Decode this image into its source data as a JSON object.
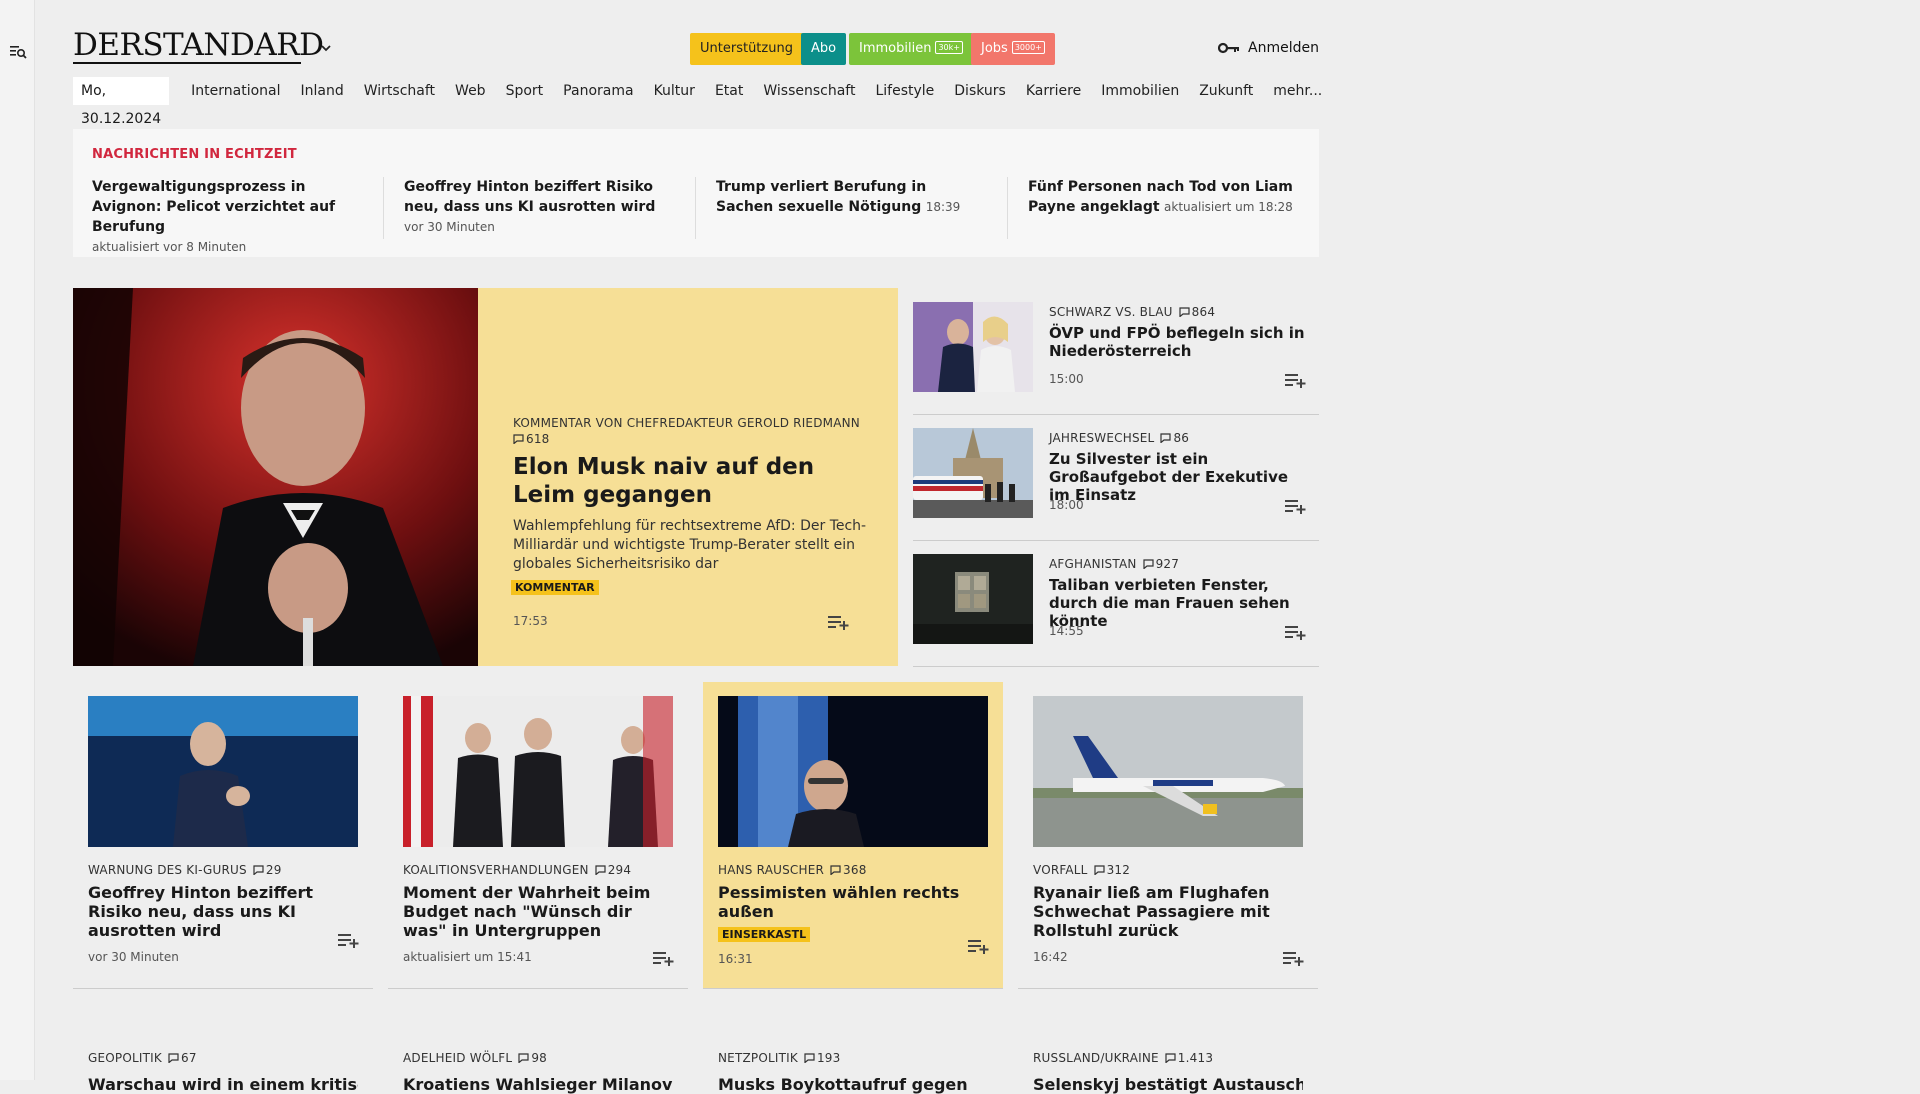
{
  "header": {
    "logo": "DERSTANDARD",
    "support_label": "Unterstützung",
    "abo_label": "Abo",
    "immo_label": "Immobilien",
    "immo_tag": "30k+",
    "jobs_label": "Jobs",
    "jobs_tag": "3000+",
    "login_label": "Anmelden"
  },
  "nav": {
    "date": "Mo, 30.12.2024",
    "items": [
      "International",
      "Inland",
      "Wirtschaft",
      "Web",
      "Sport",
      "Panorama",
      "Kultur",
      "Etat",
      "Wissenschaft",
      "Lifestyle",
      "Diskurs",
      "Karriere",
      "Immobilien",
      "Zukunft",
      "mehr..."
    ]
  },
  "ticker": {
    "title": "Nachrichten in Echtzeit",
    "items": [
      {
        "headline": "Vergewaltigungsprozess in Avignon: Pelicot verzichtet auf Berufung",
        "meta": "aktualisiert vor 8 Minuten"
      },
      {
        "headline": "Geoffrey Hinton beziffert Risiko neu, dass uns KI ausrotten wird",
        "meta": "vor 30 Minuten"
      },
      {
        "headline": "Trump verliert Berufung in Sachen se­xuelle Nötigung",
        "meta": "18:39"
      },
      {
        "headline": "Fünf Personen nach Tod von Liam Payne angeklagt",
        "meta": "aktualisiert um 18:28"
      }
    ]
  },
  "lead": {
    "kicker": "Kommentar von Chefredakteur Gerold Riedmann",
    "comments": "618",
    "title": "Elon Musk naiv auf den Leim gegangen",
    "teaser": "Wahlempfehlung für rechtsextreme AfD: Der Tech-Milliardär und wichtigste Trump-Berater stellt ein globales Sicherheitsrisiko dar",
    "badge": "Kommentar",
    "time": "17:53"
  },
  "side": [
    {
      "kicker": "Schwarz vs. Blau",
      "comments": "864",
      "title": "ÖVP und FPÖ beflegeln sich in Niederösterreich",
      "time": "15:00"
    },
    {
      "kicker": "Jahreswechsel",
      "comments": "86",
      "title": "Zu Silvester ist ein Großaufgebot der Exekutive im Einsatz",
      "time": "18:00"
    },
    {
      "kicker": "Afghanistan",
      "comments": "927",
      "title": "Taliban verbieten Fenster, durch die man Frauen sehen könnte",
      "time": "14:55"
    }
  ],
  "cards": [
    {
      "kicker": "Warnung des KI-Gurus",
      "comments": "29",
      "title": "Geoffrey Hinton beziffert Risiko neu, dass uns KI ausrotten wird",
      "badge": "",
      "time": "vor 30 Minuten"
    },
    {
      "kicker": "Koalitionsverhandlungen",
      "comments": "294",
      "title": "Moment der Wahrheit beim Budget nach \"Wünsch dir was\" in Untergruppen",
      "badge": "",
      "time": "aktualisiert um 15:41"
    },
    {
      "kicker": "Hans Rauscher",
      "comments": "368",
      "title": "Pessimisten wählen rechts außen",
      "badge": "Einserkastl",
      "time": "16:31"
    },
    {
      "kicker": "Vorfall",
      "comments": "312",
      "title": "Ryanair ließ am Flughafen Schwechat Passagiere mit Rollstuhl zurück",
      "badge": "",
      "time": "16:42"
    }
  ],
  "cards_row2": [
    {
      "kicker": "Geopolitik",
      "comments": "67",
      "title": "Warschau wird in einem kritischen"
    },
    {
      "kicker": "Adelheid Wölfl",
      "comments": "98",
      "title": "Kroatiens Wahlsieger Milanović ist"
    },
    {
      "kicker": "Netzpolitik",
      "comments": "193",
      "title": "Musks Boykottaufruf gegen"
    },
    {
      "kicker": "Russland/Ukraine",
      "comments": "1.413",
      "title": "Selenskyj bestätigt Austausch von"
    }
  ]
}
